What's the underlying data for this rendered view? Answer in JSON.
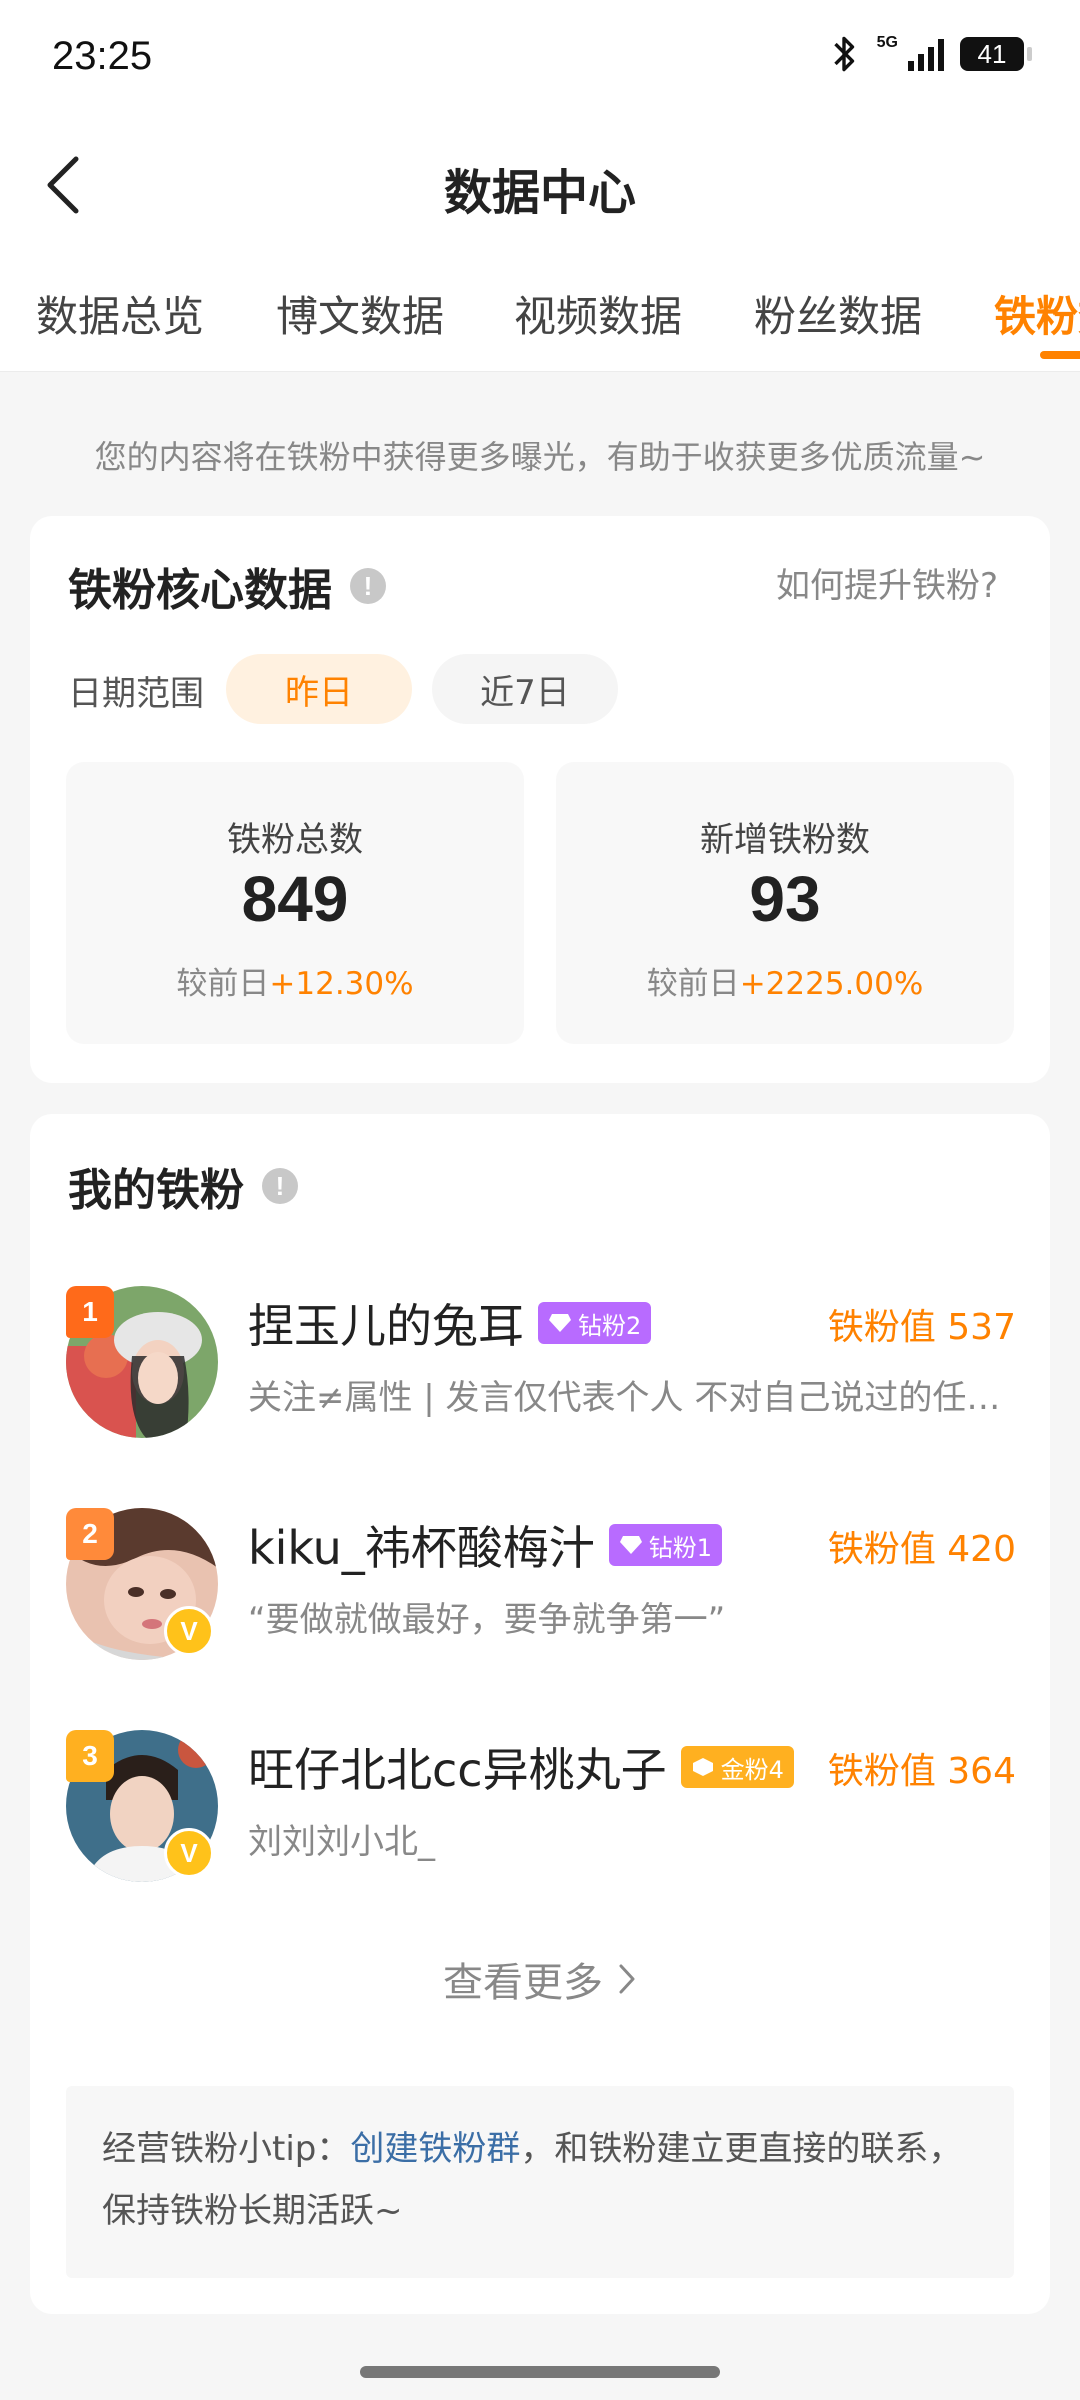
{
  "status_bar": {
    "time": "23:25",
    "network": "5G",
    "battery": "41"
  },
  "header": {
    "title": "数据中心"
  },
  "tabs": [
    {
      "label": "数据总览",
      "active": false
    },
    {
      "label": "博文数据",
      "active": false
    },
    {
      "label": "视频数据",
      "active": false
    },
    {
      "label": "粉丝数据",
      "active": false
    },
    {
      "label": "铁粉数",
      "active": true
    }
  ],
  "intro_text": "您的内容将在铁粉中获得更多曝光，有助于收获更多优质流量~",
  "core_card": {
    "title": "铁粉核心数据",
    "help_link": "如何提升铁粉?",
    "range_label": "日期范围",
    "range_options": [
      {
        "label": "昨日",
        "active": true
      },
      {
        "label": "近7日",
        "active": false
      }
    ],
    "stats": [
      {
        "label": "铁粉总数",
        "value": "849",
        "compare_prefix": "较前日",
        "delta": "+12.30%"
      },
      {
        "label": "新增铁粉数",
        "value": "93",
        "compare_prefix": "较前日",
        "delta": "+2225.00%"
      }
    ]
  },
  "fans_card": {
    "title": "我的铁粉",
    "fans": [
      {
        "rank": "1",
        "name": "捏玉儿的兔耳",
        "badge": "钻粉2",
        "badge_type": "diamond",
        "score": "铁粉值 537",
        "desc": "关注≠属性 | 发言仅代表个人 不对自己说过的任何话负责",
        "verified": false
      },
      {
        "rank": "2",
        "name": "kiku_祎杯酸梅汁",
        "badge": "钻粉1",
        "badge_type": "diamond",
        "score": "铁粉值 420",
        "desc": "“要做就做最好，要争就争第一”",
        "verified": true
      },
      {
        "rank": "3",
        "name": "旺仔北北cc异桃丸子",
        "badge": "金粉4",
        "badge_type": "gold",
        "score": "铁粉值 364",
        "desc": "刘刘刘小北_",
        "verified": true
      }
    ],
    "more_label": "查看更多",
    "tip": {
      "prefix": "经营铁粉小tip：",
      "link": "创建铁粉群",
      "suffix": "，和铁粉建立更直接的联系，保持铁粉长期活跃~"
    }
  },
  "colors": {
    "accent": "#ff8200",
    "link": "#3b6ea6",
    "diamond": "#b86bff",
    "gold": "#ffb020"
  }
}
